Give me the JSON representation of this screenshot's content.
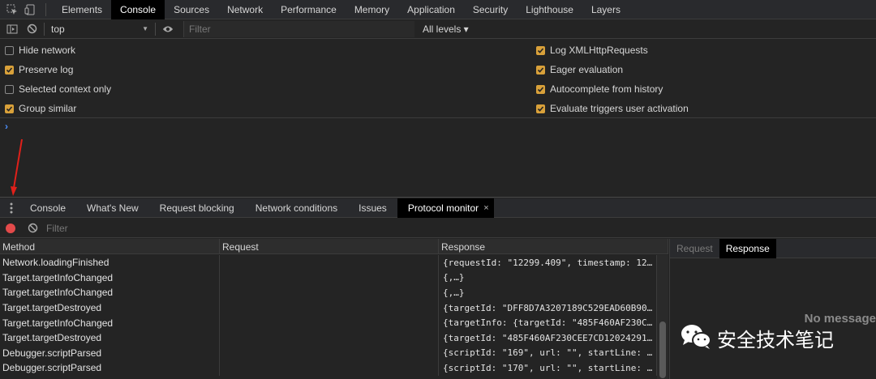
{
  "tabbar": {
    "tabs": [
      "Elements",
      "Console",
      "Sources",
      "Network",
      "Performance",
      "Memory",
      "Application",
      "Security",
      "Lighthouse",
      "Layers"
    ],
    "active_index": 1
  },
  "console_toolbar": {
    "context": "top",
    "filter_placeholder": "Filter",
    "levels": "All levels ▾"
  },
  "settings": {
    "left": [
      {
        "label": "Hide network",
        "checked": false
      },
      {
        "label": "Preserve log",
        "checked": true
      },
      {
        "label": "Selected context only",
        "checked": false
      },
      {
        "label": "Group similar",
        "checked": true
      }
    ],
    "right": [
      {
        "label": "Log XMLHttpRequests",
        "checked": true
      },
      {
        "label": "Eager evaluation",
        "checked": true
      },
      {
        "label": "Autocomplete from history",
        "checked": true
      },
      {
        "label": "Evaluate triggers user activation",
        "checked": true
      }
    ]
  },
  "console": {
    "prompt": "›"
  },
  "drawer": {
    "tabs": [
      "Console",
      "What's New",
      "Request blocking",
      "Network conditions",
      "Issues",
      "Protocol monitor"
    ],
    "active_index": 5,
    "close": "×"
  },
  "protocol_toolbar": {
    "filter_placeholder": "Filter"
  },
  "table": {
    "headers": [
      "Method",
      "Request",
      "Response"
    ],
    "rows": [
      {
        "method": "Network.loadingFinished",
        "request": "",
        "response": "{requestId: \"12299.409\", timestamp: 12…"
      },
      {
        "method": "Target.targetInfoChanged",
        "request": "",
        "response": "{,…}"
      },
      {
        "method": "Target.targetInfoChanged",
        "request": "",
        "response": "{,…}"
      },
      {
        "method": "Target.targetDestroyed",
        "request": "",
        "response": "{targetId: \"DFF8D7A3207189C529EAD60B90…"
      },
      {
        "method": "Target.targetInfoChanged",
        "request": "",
        "response": "{targetInfo: {targetId: \"485F460AF230C…"
      },
      {
        "method": "Target.targetDestroyed",
        "request": "",
        "response": "{targetId: \"485F460AF230CEE7CD12024291…"
      },
      {
        "method": "Debugger.scriptParsed",
        "request": "",
        "response": "{scriptId: \"169\", url: \"\", startLine: …"
      },
      {
        "method": "Debugger.scriptParsed",
        "request": "",
        "response": "{scriptId: \"170\", url: \"\", startLine: …"
      }
    ]
  },
  "side_panel": {
    "tabs": [
      "Request",
      "Response"
    ],
    "active_index": 1,
    "empty_text": "No message",
    "watermark": "安全技术笔记"
  },
  "colors": {
    "accent": "#d9a13a",
    "record": "#e34a4a",
    "annotation_arrow": "#e0201a"
  }
}
